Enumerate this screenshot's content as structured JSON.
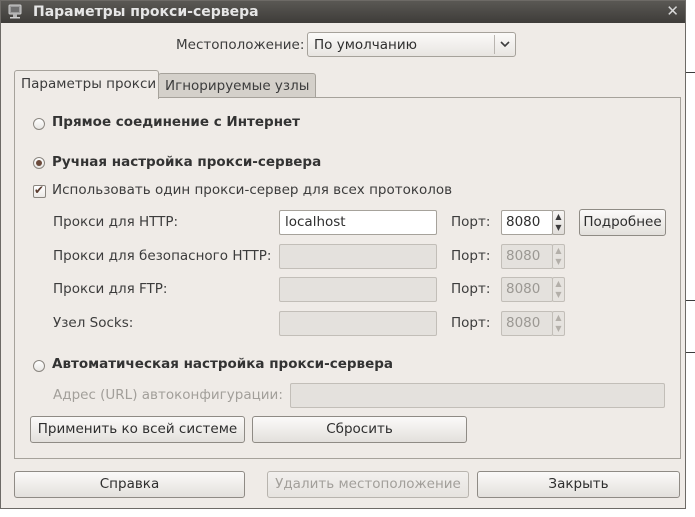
{
  "window": {
    "title": "Параметры прокси-сервера",
    "close_glyph": "✕"
  },
  "location": {
    "label": "Местоположение:",
    "value": "По умолчанию"
  },
  "tabs": [
    {
      "label": "Параметры прокси",
      "active": true
    },
    {
      "label": "Игнорируемые узлы",
      "active": false
    }
  ],
  "options": {
    "direct": {
      "label": "Прямое соединение с Интернет",
      "selected": false
    },
    "manual": {
      "label": "Ручная настройка прокси-сервера",
      "selected": true
    },
    "same_proxy": {
      "label": "Использовать один прокси-сервер для всех протоколов",
      "checked": true
    },
    "auto": {
      "label": "Автоматическая настройка прокси-сервера",
      "selected": false
    }
  },
  "proxies": {
    "port_label": "Порт:",
    "http": {
      "label": "Прокси для HTTP:",
      "host": "localhost",
      "port": "8080",
      "details_label": "Подробнее"
    },
    "https": {
      "label": "Прокси для безопасного HTTP:",
      "host": "",
      "port": "8080"
    },
    "ftp": {
      "label": "Прокси для FTP:",
      "host": "",
      "port": "8080"
    },
    "socks": {
      "label": "Узел Socks:",
      "host": "",
      "port": "8080"
    }
  },
  "autoconfig": {
    "label": "Адрес (URL) автоконфигурации:",
    "value": ""
  },
  "buttons": {
    "apply_system": "Применить ко всей системе",
    "reset": "Сбросить",
    "help": "Справка",
    "delete_location": "Удалить местоположение",
    "close": "Закрыть"
  },
  "icons": {
    "app": "proxy-settings-icon",
    "combo_arrow": "chevron-down-icon",
    "spin_up": "▲",
    "spin_down": "▼"
  },
  "colors": {
    "titlebar": "#3e3c39",
    "window_bg": "#efebe7",
    "radio_selected": "#6b4a3b"
  }
}
